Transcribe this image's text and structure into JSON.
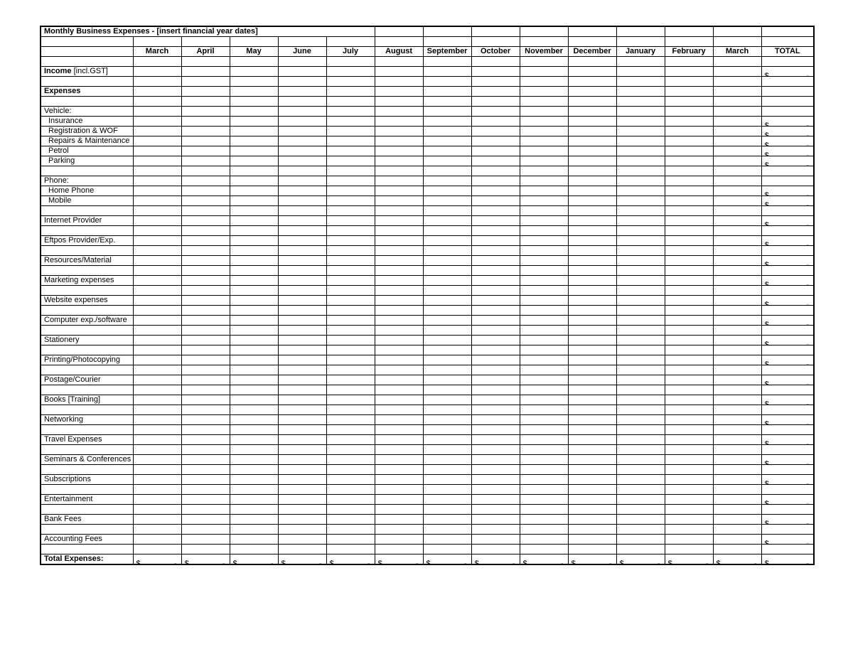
{
  "title": "Monthly Business Expenses - [insert financial year dates]",
  "months": [
    "March",
    "April",
    "May",
    "June",
    "July",
    "August",
    "September",
    "October",
    "November",
    "December",
    "January",
    "February",
    "March"
  ],
  "total_label": "TOTAL",
  "currency_symbol": "$",
  "dash": "-",
  "income": {
    "label_bold": "Income",
    "label_rest": " [incl.GST]"
  },
  "expenses_header": "Expenses",
  "sections": [
    {
      "header": "Vehicle:",
      "items": [
        "Insurance",
        "Registration & WOF",
        "Repairs & Maintenance",
        "Petrol",
        "Parking"
      ]
    },
    {
      "header": "Phone:",
      "items": [
        "Home Phone",
        "Mobile"
      ]
    }
  ],
  "single_lines": [
    "Internet Provider",
    "Eftpos Provider/Exp.",
    "Resources/Material",
    "Marketing expenses",
    "Website expenses",
    "Computer exp./software",
    "Stationery",
    "Printing/Photocopying",
    "Postage/Courier",
    "Books [Training]",
    "Networking",
    "Travel Expenses",
    "Seminars & Conferences",
    "Subscriptions",
    "Entertainment",
    "Bank Fees",
    "Accounting Fees"
  ],
  "total_expenses_label": "Total Expenses:"
}
